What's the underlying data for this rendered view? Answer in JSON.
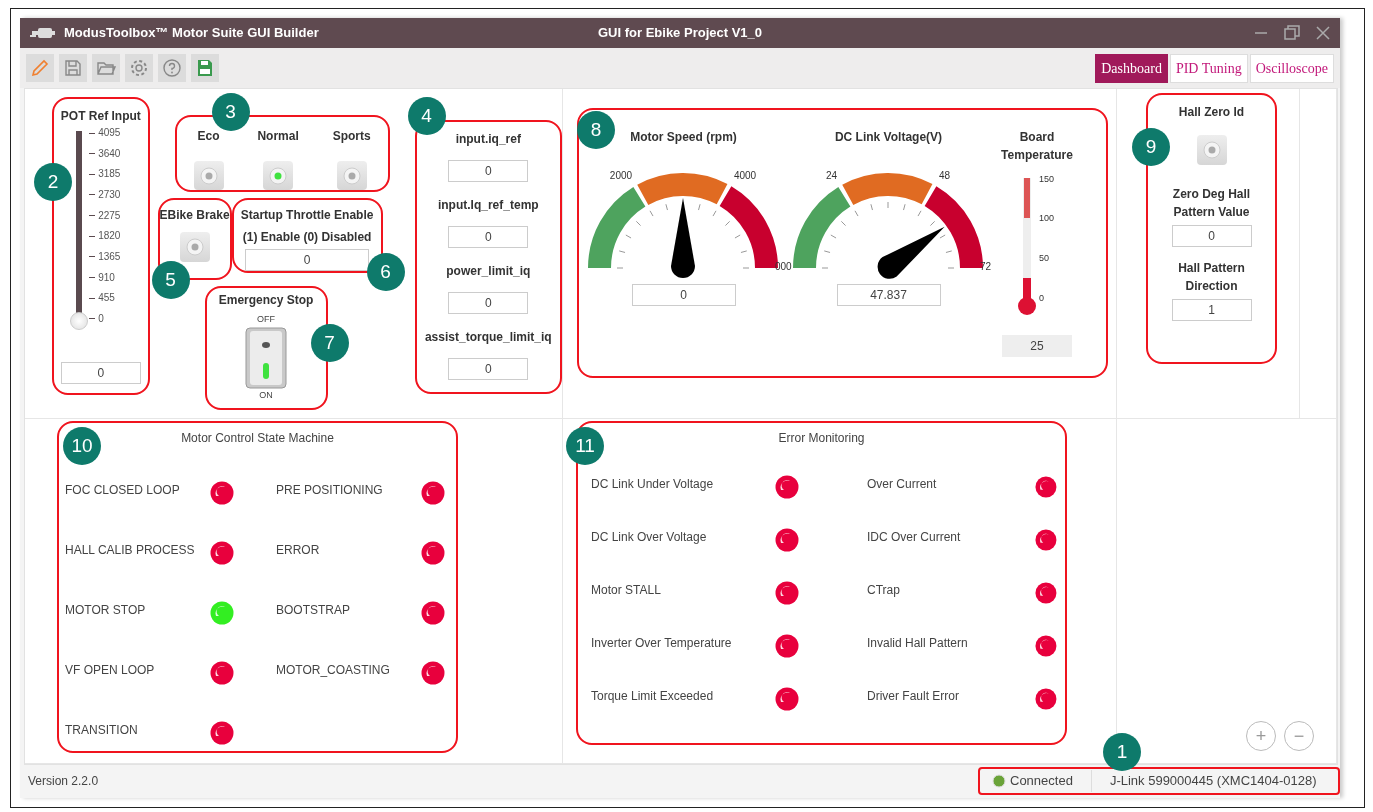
{
  "window": {
    "app_title": "ModusToolbox™ Motor Suite GUI Builder",
    "project_title": "GUI for Ebike Project V1_0"
  },
  "toolbar": [
    {
      "kind": "edit"
    },
    {
      "kind": "save"
    },
    {
      "kind": "open"
    },
    {
      "kind": "settings"
    },
    {
      "kind": "help"
    },
    {
      "kind": "export"
    }
  ],
  "tabs": [
    {
      "label": "Dashboard",
      "selected": true
    },
    {
      "label": "PID Tuning",
      "selected": false
    },
    {
      "label": "Oscilloscope",
      "selected": false
    }
  ],
  "pot": {
    "callout": "2",
    "title": "POT Ref Input",
    "ticks": [
      "4095",
      "3640",
      "3185",
      "2730",
      "2275",
      "1820",
      "1365",
      "910",
      "455",
      "0"
    ],
    "level": 0,
    "value": "0"
  },
  "modes": {
    "callout": "3",
    "items": [
      {
        "label": "Eco",
        "selected": false
      },
      {
        "label": "Normal",
        "selected": true
      },
      {
        "label": "Sports",
        "selected": false
      }
    ]
  },
  "brake": {
    "callout": "5",
    "title": "EBike Brake",
    "on": false
  },
  "throttle": {
    "callout": "6",
    "title": "Startup Throttle Enable",
    "subtitle": "(1) Enable (0) Disabled",
    "value": "0"
  },
  "emergency": {
    "callout": "7",
    "title": "Emergency Stop",
    "off_label": "OFF",
    "on_label": "ON",
    "on": true
  },
  "iq_inputs": {
    "callout": "4",
    "fields": [
      {
        "label": "input.iq_ref",
        "value": "0"
      },
      {
        "label": "input.Iq_ref_temp",
        "value": "0"
      },
      {
        "label": "power_limit_iq",
        "value": "0"
      },
      {
        "label": "assist_torque_limit_iq",
        "value": "0"
      }
    ]
  },
  "gauges": {
    "callout": "8",
    "dials": [
      {
        "title": "Motor Speed (rpm)",
        "scale": [
          "2000",
          "4000",
          "000"
        ],
        "value": "0"
      },
      {
        "title": "DC Link Voltage(V)",
        "scale": [
          "24",
          "48",
          "72"
        ],
        "value": "47.837"
      }
    ],
    "thermometer": {
      "title": "Board Temperature",
      "scale": [
        "150",
        "100",
        "50",
        "0"
      ],
      "value": "25"
    }
  },
  "hall": {
    "callout": "9",
    "title": "Hall Zero Id",
    "on": false,
    "fields": [
      {
        "label": "Zero Deg Hall Pattern Value",
        "value": "0"
      },
      {
        "label": "Hall Pattern Direction",
        "value": "1"
      }
    ]
  },
  "state_machine": {
    "callout": "10",
    "title": "Motor Control State Machine",
    "states": [
      {
        "label": "FOC CLOSED LOOP",
        "active": false
      },
      {
        "label": "PRE POSITIONING",
        "active": false
      },
      {
        "label": "HALL CALIB PROCESS",
        "active": false
      },
      {
        "label": "ERROR",
        "active": false
      },
      {
        "label": "MOTOR STOP",
        "active": true
      },
      {
        "label": "BOOTSTRAP",
        "active": false
      },
      {
        "label": "VF OPEN LOOP",
        "active": false
      },
      {
        "label": "MOTOR_COASTING",
        "active": false
      },
      {
        "label": "TRANSITION",
        "active": false
      }
    ]
  },
  "errors": {
    "callout": "11",
    "title": "Error Monitoring",
    "items": [
      {
        "label": "DC Link Under Voltage",
        "active": false
      },
      {
        "label": "Over Current",
        "active": false
      },
      {
        "label": "DC Link Over Voltage",
        "active": false
      },
      {
        "label": "IDC Over Current",
        "active": false
      },
      {
        "label": "Motor STALL",
        "active": false
      },
      {
        "label": "CTrap",
        "active": false
      },
      {
        "label": "Inverter Over Temperature",
        "active": false
      },
      {
        "label": "Invalid Hall Pattern",
        "active": false
      },
      {
        "label": "Torque Limit Exceeded",
        "active": false
      },
      {
        "label": "Driver Fault Error",
        "active": false
      }
    ]
  },
  "zoom_buttons": [
    "+",
    "−"
  ],
  "status_bar": {
    "version": "Version 2.2.0",
    "callout": "1",
    "connection": "Connected",
    "connected": true,
    "device": "J-Link 599000445 (XMC1404-0128)"
  }
}
